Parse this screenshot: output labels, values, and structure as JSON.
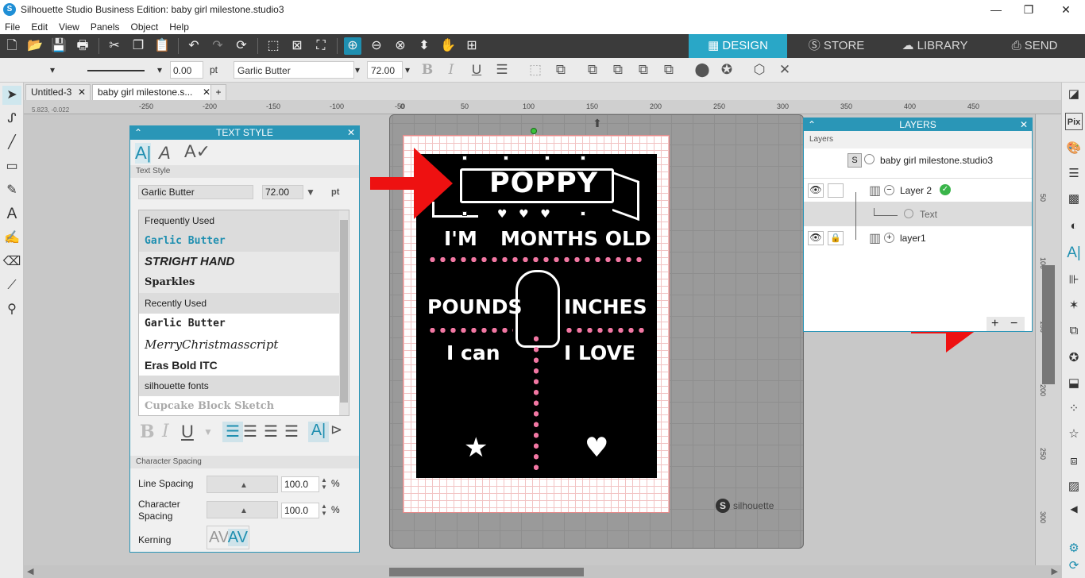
{
  "window": {
    "title": "Silhouette Studio Business Edition: baby girl milestone.studio3",
    "min": "—",
    "max": "❐",
    "close": "✕"
  },
  "menu": [
    "File",
    "Edit",
    "View",
    "Panels",
    "Object",
    "Help"
  ],
  "nav_tabs": [
    {
      "label": "DESIGN",
      "icon": "grid-icon"
    },
    {
      "label": "STORE",
      "icon": "silhouette-s-icon"
    },
    {
      "label": "LIBRARY",
      "icon": "cloud-icon"
    },
    {
      "label": "SEND",
      "icon": "cutter-icon"
    }
  ],
  "toolbar2": {
    "line_width": "0.00",
    "unit": "pt",
    "font_name": "Garlic Butter",
    "font_size": "72.00",
    "bold": "B",
    "italic": "I",
    "underline": "U"
  },
  "doc_tabs": {
    "tab1": "Untitled-3",
    "tab2": "baby girl milestone.s...",
    "add": "+"
  },
  "ruler": {
    "coords": "5.823, -0.022",
    "top_labels": [
      "-250",
      "-200",
      "-150",
      "-100",
      "-50",
      "0",
      "50",
      "100",
      "150",
      "200",
      "250",
      "300",
      "350",
      "400",
      "450"
    ],
    "right_labels": [
      "50",
      "100",
      "150",
      "200",
      "250",
      "300"
    ]
  },
  "text_style_panel": {
    "title": "TEXT STYLE",
    "tab_section": "Text Style",
    "font": "Garlic Butter",
    "size": "72.00",
    "unit": "pt",
    "frequently_used": "Frequently Used",
    "fonts_freq": [
      "Garlic Butter",
      "STRIGHT HAND",
      "Sparkles"
    ],
    "recently_used": "Recently Used",
    "fonts_recent": [
      "Garlic Butter",
      "MerryChristmasscript",
      "Eras Bold ITC"
    ],
    "silhouette_fonts": "silhouette fonts",
    "fonts_sil": [
      "Cupcake Block Sketch"
    ],
    "char_spacing": "Character Spacing",
    "line_spacing_label": "Line Spacing",
    "line_spacing": "100.0",
    "character_spacing_label": "Character Spacing",
    "character_spacing": "100.0",
    "percent": "%",
    "kerning_label": "Kerning",
    "kerning_off": "AV",
    "kerning_on": "AV"
  },
  "layers_panel": {
    "title": "LAYERS",
    "section": "Layers",
    "doc": "baby girl milestone.studio3",
    "layer2": "Layer 2",
    "text": "Text",
    "layer1": "layer1",
    "add": "+",
    "remove": "−"
  },
  "design": {
    "name": "POPPY",
    "line1a": "I'M",
    "line1b": "MONTHS OLD",
    "line2a": "POUNDS",
    "line2b": "INCHES",
    "line3a": "I can",
    "line3b": "I LOVE"
  },
  "mat": {
    "brand": "silhouette"
  },
  "colors": {
    "accent": "#2a96b7",
    "toolbar": "#3b3b3b",
    "pink": "#f277a3",
    "arrow": "#ee1111"
  }
}
